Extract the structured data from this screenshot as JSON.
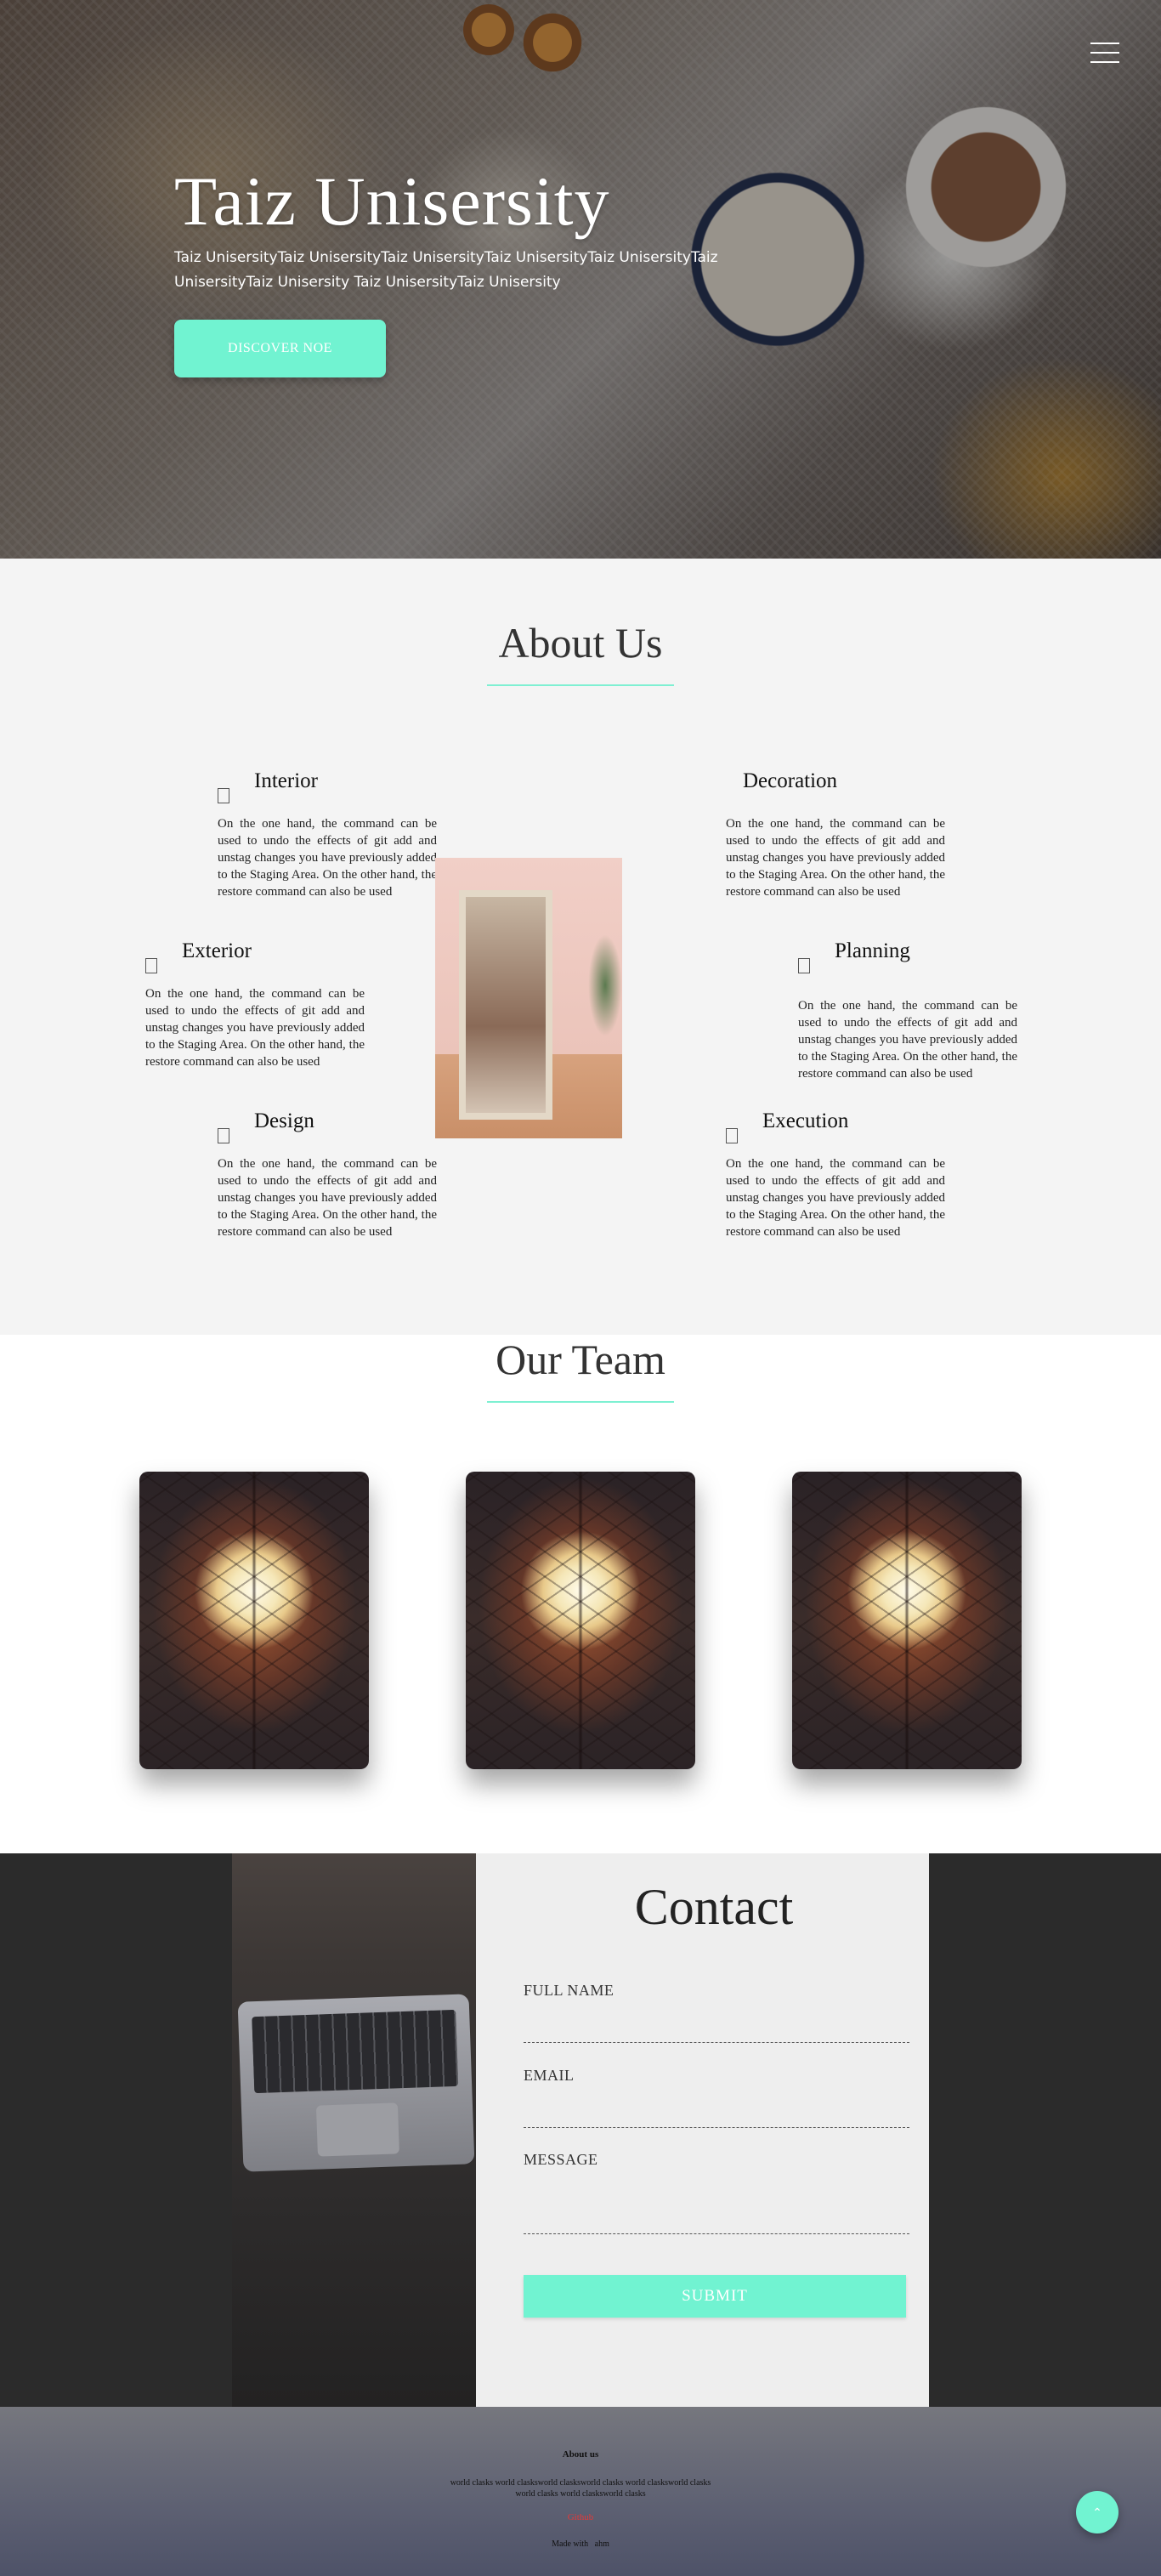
{
  "hero": {
    "title": "Taiz Unisersity",
    "subtitle": "Taiz UnisersityTaiz UnisersityTaiz UnisersityTaiz UnisersityTaiz UnisersityTaiz UnisersityTaiz Unisersity Taiz UnisersityTaiz Unisersity",
    "button": "DISCOVER NOE",
    "menu_icon": "hamburger-icon"
  },
  "about": {
    "title": "About Us",
    "features": [
      {
        "title": "Interior",
        "text": "On the one hand, the command can be used to undo the effects of git add and unstag changes you have previously added to the Staging Area. On the other hand, the restore command can also be used",
        "icon": "interior-icon"
      },
      {
        "title": "Decoration",
        "text": "On the one hand, the command can be used to undo the effects of git add and unstag changes you have previously added to the Staging Area. On the other hand, the restore command can also be used",
        "icon": "decoration-icon"
      },
      {
        "title": "Exterior",
        "text": "On the one hand, the command can be used to undo the effects of git add and unstag changes you have previously added to the Staging Area. On the other hand, the restore command can also be used",
        "icon": "exterior-icon"
      },
      {
        "title": "Planning",
        "text": "On the one hand, the command can be used to undo the effects of git add and unstag changes you have previously added to the Staging Area. On the other hand, the restore command can also be used",
        "icon": "planning-icon"
      },
      {
        "title": "Design",
        "text": "On the one hand, the command can be used to undo the effects of git add and unstag changes you have previously added to the Staging Area. On the other hand, the restore command can also be used",
        "icon": "design-icon"
      },
      {
        "title": "Execution",
        "text": "On the one hand, the command can be used to undo the effects of git add and unstag changes you have previously added to the Staging Area. On the other hand, the restore command can also be used",
        "icon": "execution-icon"
      }
    ]
  },
  "team": {
    "title": "Our Team"
  },
  "contact": {
    "title": "Contact",
    "full_name_label": "FULL NAME",
    "email_label": "EMAIL",
    "message_label": "MESSAGE",
    "submit": "SUBMIT"
  },
  "footer": {
    "heading": "About us",
    "text": "world clasks world clasksworld clasksworld clasks world clasksworld clasks world clasks world clasksworld clasks",
    "link": "Github",
    "made_with": "Made with   ahm"
  },
  "colors": {
    "accent": "#71f3d1",
    "footer_link": "#e23a3a"
  }
}
